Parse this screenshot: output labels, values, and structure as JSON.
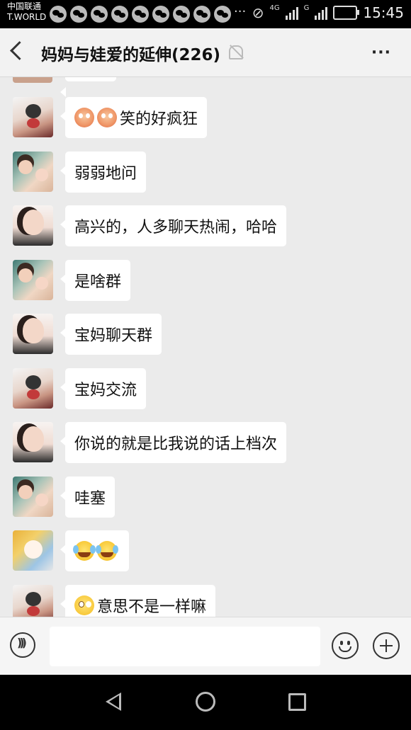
{
  "status_bar": {
    "carrier_line1": "中国联通",
    "carrier_line2": "T.WORLD",
    "notification_icons": [
      "wechat-icon",
      "wechat-icon",
      "wechat-icon",
      "wechat-icon",
      "wechat-icon",
      "wechat-icon",
      "wechat-icon",
      "wechat-icon",
      "wechat-icon"
    ],
    "more_notifications": "···",
    "network_1": "4G",
    "network_2": "G",
    "time": "15:45"
  },
  "header": {
    "title": "妈妈与娃爱的延伸(226)",
    "back_icon": "chevron-left-icon",
    "mute_icon": "bell-off-icon",
    "more_icon": "more-dots-icon",
    "more_label": "···"
  },
  "messages": [
    {
      "avatar": "avatar-crying-baby",
      "emojis": [
        "flushed-emoji",
        "flushed-emoji"
      ],
      "text": "笑的好疯狂"
    },
    {
      "avatar": "avatar-mother-child",
      "emojis": [],
      "text": "弱弱地问"
    },
    {
      "avatar": "avatar-woman",
      "emojis": [],
      "text": "高兴的，人多聊天热闹，哈哈"
    },
    {
      "avatar": "avatar-mother-child",
      "emojis": [],
      "text": "是啥群"
    },
    {
      "avatar": "avatar-woman",
      "emojis": [],
      "text": "宝妈聊天群"
    },
    {
      "avatar": "avatar-crying-baby",
      "emojis": [],
      "text": "宝妈交流"
    },
    {
      "avatar": "avatar-woman",
      "emojis": [],
      "text": "你说的就是比我说的话上档次"
    },
    {
      "avatar": "avatar-mother-child",
      "emojis": [],
      "text": "哇塞"
    },
    {
      "avatar": "avatar-baby-fruit",
      "emojis": [
        "tears-of-joy-emoji",
        "tears-of-joy-emoji"
      ],
      "text": ""
    },
    {
      "avatar": "avatar-crying-baby",
      "emojis": [
        "dizzy-face-emoji"
      ],
      "text": "意思不是一样嘛"
    }
  ],
  "input_bar": {
    "voice_icon": "voice-icon",
    "input_value": "",
    "emoji_icon": "smiley-icon",
    "plus_icon": "plus-circle-icon"
  },
  "nav_bar": {
    "back_icon": "nav-back-triangle-icon",
    "home_icon": "nav-home-circle-icon",
    "recents_icon": "nav-recents-square-icon"
  }
}
